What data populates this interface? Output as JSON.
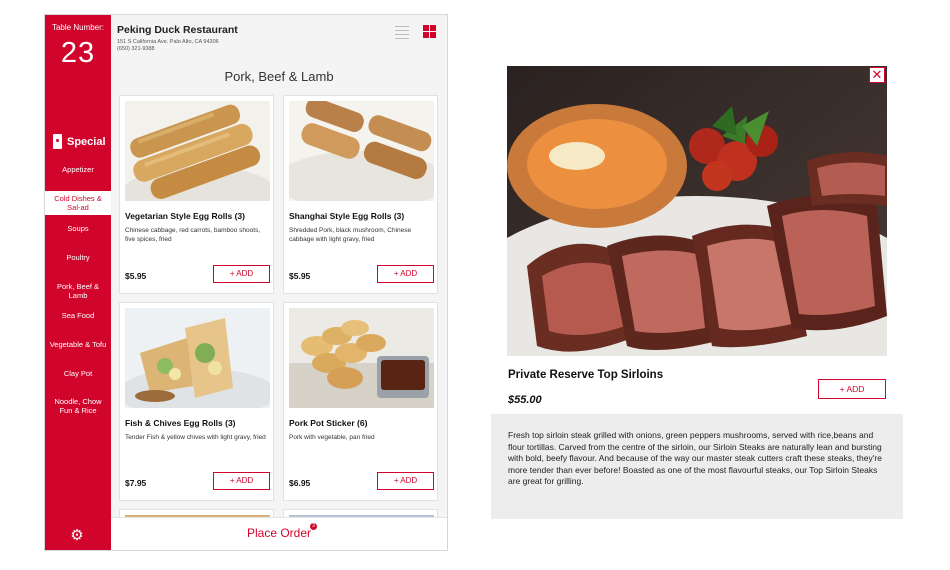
{
  "sidebar": {
    "table_label": "Table Number:",
    "table_number": "23",
    "special_label": "Special",
    "categories": [
      "Appetizer",
      "Cold Dishes & Sal-ad",
      "Soups",
      "Poultry",
      "Pork, Beef & Lamb",
      "Sea Food",
      "Vegetable & Tofu",
      "Clay Pot",
      "Noodle, Chow Fun & Rice"
    ],
    "active_category": "Cold Dishes & Sal-ad",
    "settings_icon": "gear-icon"
  },
  "header": {
    "restaurant_name": "Peking Duck Restaurant",
    "address_line1": "151 S California Ave. Palo Alto, CA 94306",
    "address_line2": "(650) 321-9388",
    "view_icons": [
      "list-view-icon",
      "grid-view-icon"
    ]
  },
  "section_title": "Pork, Beef & Lamb",
  "menu_items": [
    {
      "name": "Vegetarian Style Egg Rolls (3)",
      "description": "Chinese cabbage, red carrots, bamboo shoots, five spices, fried",
      "price": "$5.95",
      "add_label": "+ ADD"
    },
    {
      "name": "Shanghai Style Egg Rolls (3)",
      "description": "Shredded Pork, black mushroom, Chinese cabbage with light gravy, fried",
      "price": "$5.95",
      "add_label": "+ ADD"
    },
    {
      "name": "Fish & Chives Egg Rolls (3)",
      "description": "Tender Fish & yellow chives with light gravy, fried",
      "price": "$7.95",
      "add_label": "+ ADD"
    },
    {
      "name": "Pork Pot Sticker (6)",
      "description": "Pork with vegetable, pan fried",
      "price": "$6.95",
      "add_label": "+ ADD"
    }
  ],
  "place_order": {
    "label": "Place Order",
    "count": "3"
  },
  "detail": {
    "title": "Private Reserve Top Sirloins",
    "price": "$55.00",
    "add_label": "+  ADD",
    "close_label": "✕",
    "description": "Fresh top sirloin steak grilled with onions, green peppers mushrooms, served with rice,beans and flour tortillas. Carved from the centre of the sirloin, our Sirloin Steaks are naturally lean and bursting with bold, beefy flavour. And because of the way our master steak cutters craft these steaks, they're more tender than ever before! Boasted as one of the most flavourful steaks, our Top Sirloin Steaks are great for grilling."
  },
  "colors": {
    "accent": "#d1052c",
    "panel_bg": "#ededed",
    "app_bg": "#f4f4f5"
  }
}
